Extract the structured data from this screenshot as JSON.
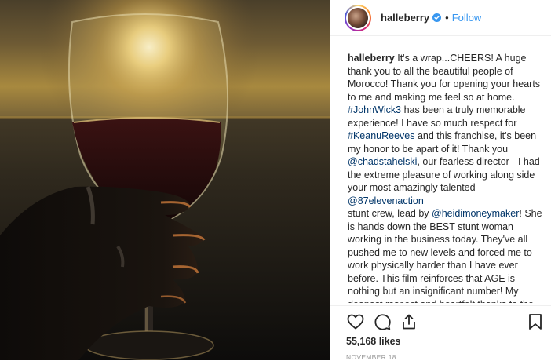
{
  "post": {
    "username": "halleberry",
    "verified_icon": "verified-badge-icon",
    "separator": "•",
    "follow_label": "Follow",
    "caption": {
      "username": "halleberry",
      "segments": [
        {
          "type": "text",
          "text": " It's a wrap...CHEERS! A huge thank you to all the beautiful people of Morocco! Thank you for opening your hearts to me and making me feel so at home. "
        },
        {
          "type": "link",
          "text": "#JohnWick3"
        },
        {
          "type": "text",
          "text": " has been a truly memorable experience!  I have so much respect for "
        },
        {
          "type": "link",
          "text": "#KeanuReeves"
        },
        {
          "type": "text",
          "text": " and this franchise, it's been my honor to be apart of it! Thank you "
        },
        {
          "type": "link",
          "text": "@chadstahelski"
        },
        {
          "type": "text",
          "text": ", our fearless director - I had the extreme pleasure of working along side your most amazingly talented "
        },
        {
          "type": "link",
          "text": "@87elevenaction"
        },
        {
          "type": "break"
        },
        {
          "type": "text",
          "text": "stunt crew, lead by "
        },
        {
          "type": "link",
          "text": "@heidimoneymaker"
        },
        {
          "type": "text",
          "text": "! She is hands down the BEST stunt woman working in the business today. They've all pushed me to new levels and forced me to work physically harder than I have ever before. This film reinforces that AGE is nothing but an insignificant number! My deepest respect and heartfelt thanks to the"
        }
      ]
    },
    "actions": {
      "like_icon": "heart-icon",
      "comment_icon": "comment-icon",
      "share_icon": "share-icon",
      "save_icon": "bookmark-icon"
    },
    "likes_label": "55,168 likes",
    "date_label": "NOVEMBER 18"
  },
  "colors": {
    "link": "#003569",
    "follow": "#3897f0",
    "verified": "#3897f0",
    "muted": "#999999"
  }
}
